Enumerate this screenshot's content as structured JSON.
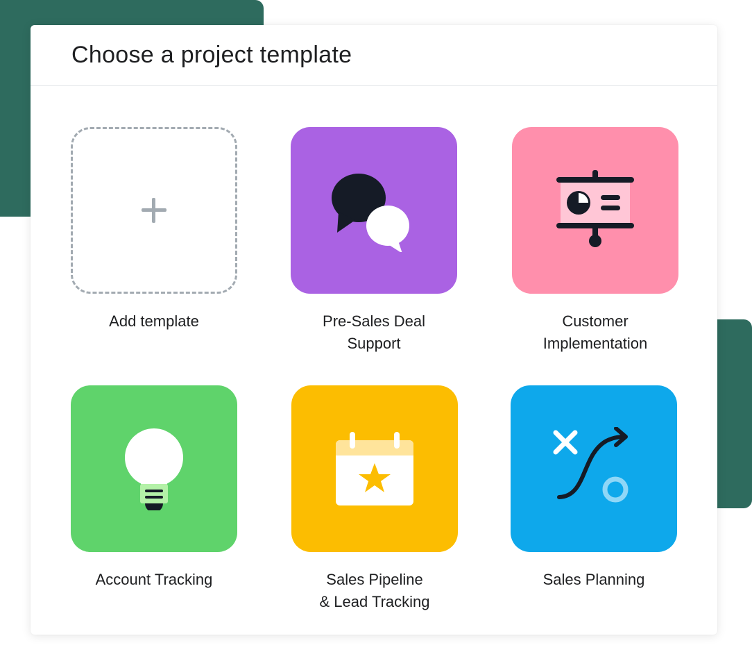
{
  "dialog": {
    "title": "Choose a project template"
  },
  "templates": [
    {
      "label": "Add template",
      "icon": "plus-icon",
      "color": "#ffffff"
    },
    {
      "label": "Pre-Sales Deal\nSupport",
      "icon": "chat-bubbles-icon",
      "color": "#aa62e3"
    },
    {
      "label": "Customer\nImplementation",
      "icon": "presentation-board-icon",
      "color": "#ff8fac"
    },
    {
      "label": "Account Tracking",
      "icon": "lightbulb-icon",
      "color": "#5fd36b"
    },
    {
      "label": "Sales Pipeline\n& Lead Tracking",
      "icon": "calendar-star-icon",
      "color": "#fcbd01"
    },
    {
      "label": "Sales Planning",
      "icon": "strategy-play-icon",
      "color": "#0ea8eb"
    }
  ],
  "colors": {
    "accent_dark_green": "#2e6b5e",
    "icon_dark": "#151b26"
  }
}
